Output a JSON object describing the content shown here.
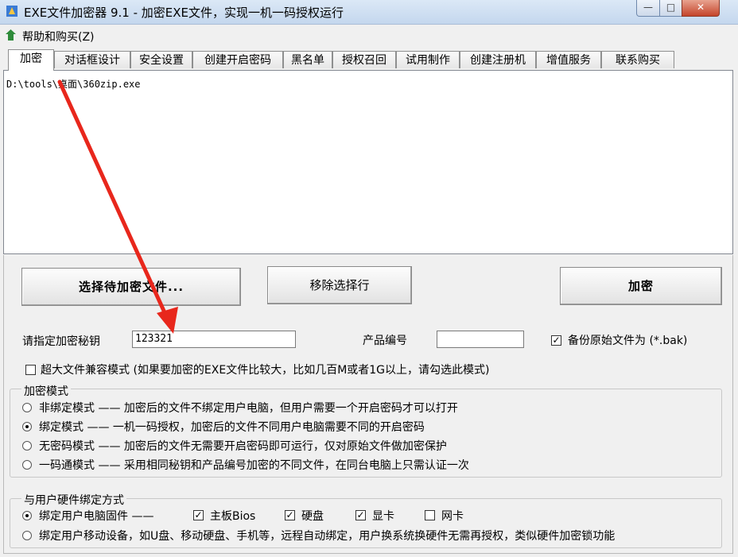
{
  "window": {
    "title": "EXE文件加密器 9.1 - 加密EXE文件，实现一机一码授权运行",
    "minimize_glyph": "—",
    "maximize_glyph": "□",
    "close_glyph": "✕"
  },
  "menu": {
    "help_label": "帮助和购买(Z)"
  },
  "tabs": [
    {
      "label": "加密"
    },
    {
      "label": "对话框设计"
    },
    {
      "label": "安全设置"
    },
    {
      "label": "创建开启密码"
    },
    {
      "label": "黑名单"
    },
    {
      "label": "授权召回"
    },
    {
      "label": "试用制作"
    },
    {
      "label": "创建注册机"
    },
    {
      "label": "增值服务"
    },
    {
      "label": "联系购买"
    }
  ],
  "file_list": {
    "items": [
      "D:\\tools\\桌面\\360zip.exe"
    ]
  },
  "buttons": {
    "select_files": "选择待加密文件...",
    "remove_selected": "移除选择行",
    "encrypt": "加密"
  },
  "key_field": {
    "label": "请指定加密秘钥",
    "value": "123321"
  },
  "product_field": {
    "label": "产品编号",
    "value": ""
  },
  "backup": {
    "label": "备份原始文件为 (*.bak)",
    "checked": true,
    "check_glyph": "✓"
  },
  "large_file": {
    "label": "超大文件兼容模式 (如果要加密的EXE文件比较大，比如几百M或者1G以上，请勾选此模式)",
    "checked": false
  },
  "encrypt_mode": {
    "title": "加密模式",
    "options": [
      {
        "label": "非绑定模式 —— 加密后的文件不绑定用户电脑，但用户需要一个开启密码才可以打开",
        "selected": false
      },
      {
        "label": "绑定模式 —— 一机一码授权，加密后的文件不同用户电脑需要不同的开启密码",
        "selected": true
      },
      {
        "label": "无密码模式 —— 加密后的文件无需要开启密码即可运行，仅对原始文件做加密保护",
        "selected": false
      },
      {
        "label": "一码通模式 —— 采用相同秘钥和产品编号加密的不同文件，在同台电脑上只需认证一次",
        "selected": false
      }
    ]
  },
  "hardware_bind": {
    "title": "与用户硬件绑定方式",
    "firmware_label": "绑定用户电脑固件 ——",
    "firmware_selected": true,
    "checks": [
      {
        "label": "主板Bios",
        "checked": true
      },
      {
        "label": "硬盘",
        "checked": true
      },
      {
        "label": "显卡",
        "checked": true
      },
      {
        "label": "网卡",
        "checked": false
      }
    ],
    "mobile_label": "绑定用户移动设备，如U盘、移动硬盘、手机等，远程自动绑定，用户换系统换硬件无需再授权，类似硬件加密锁功能",
    "mobile_selected": false
  },
  "colors": {
    "arrow": "#e8271c",
    "accent": "#1e6fd8"
  }
}
